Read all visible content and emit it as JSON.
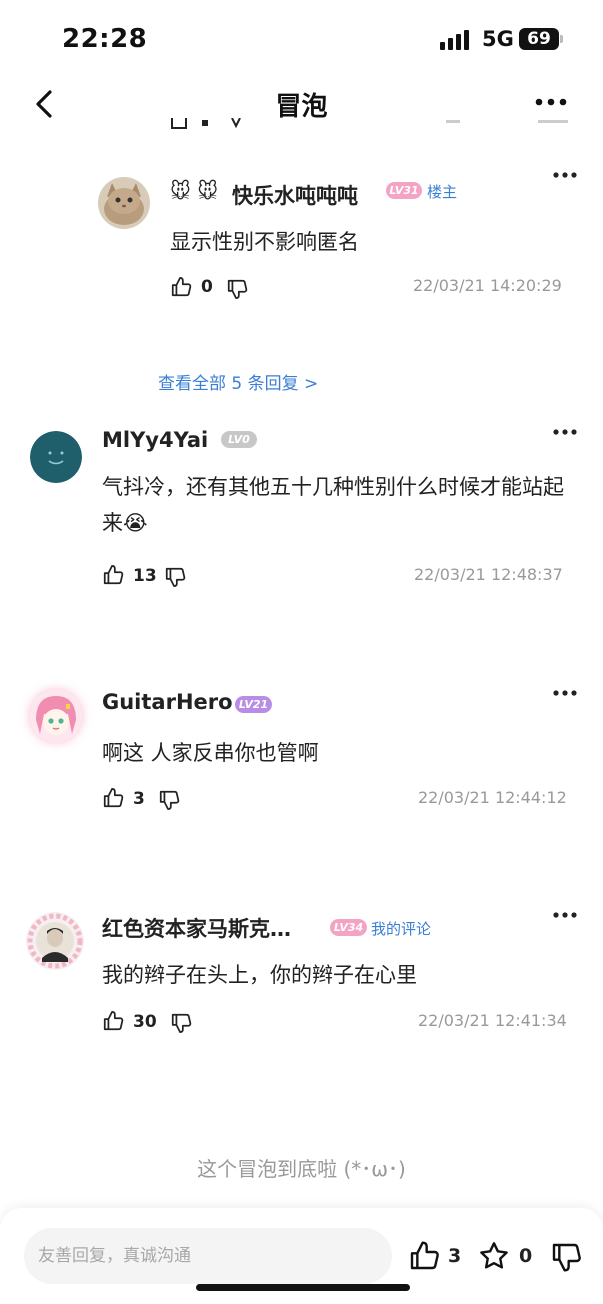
{
  "status_bar": {
    "time": "22:28",
    "network": "5G",
    "battery": "69"
  },
  "header": {
    "title": "冒泡"
  },
  "comments": [
    {
      "emojis": "🐭 🐭",
      "username": "快乐水吨吨吨",
      "level": "LV31",
      "level_color": "#f4a3c4",
      "tag": "楼主",
      "content": "显示性别不影响匿名",
      "likes": "0",
      "time": "22/03/21 14:20:29"
    },
    {
      "username": "MlYy4Yai",
      "level": "LV0",
      "level_color": "#c7c7c7",
      "content": "气抖冷，还有其他五十几种性别什么时候才能站起来😭",
      "likes": "13",
      "time": "22/03/21 12:48:37"
    },
    {
      "username": "GuitarHero",
      "level": "LV21",
      "level_color": "#b98de6",
      "content": "啊这 人家反串你也管啊",
      "likes": "3",
      "time": "22/03/21 12:44:12"
    },
    {
      "username": "红色资本家马斯克…",
      "level": "LV34",
      "level_color": "#f4a3c4",
      "tag": "我的评论",
      "content": "我的辫子在头上，你的辫子在心里",
      "likes": "30",
      "time": "22/03/21 12:41:34"
    }
  ],
  "view_all_replies": "查看全部 5 条回复 >",
  "end_note": "这个冒泡到底啦 (*･ω･)",
  "bottom_bar": {
    "placeholder": "友善回复，真诚沟通",
    "like_count": "3",
    "star_count": "0"
  },
  "colors": {
    "link": "#3a7fd6",
    "muted": "#999999"
  }
}
